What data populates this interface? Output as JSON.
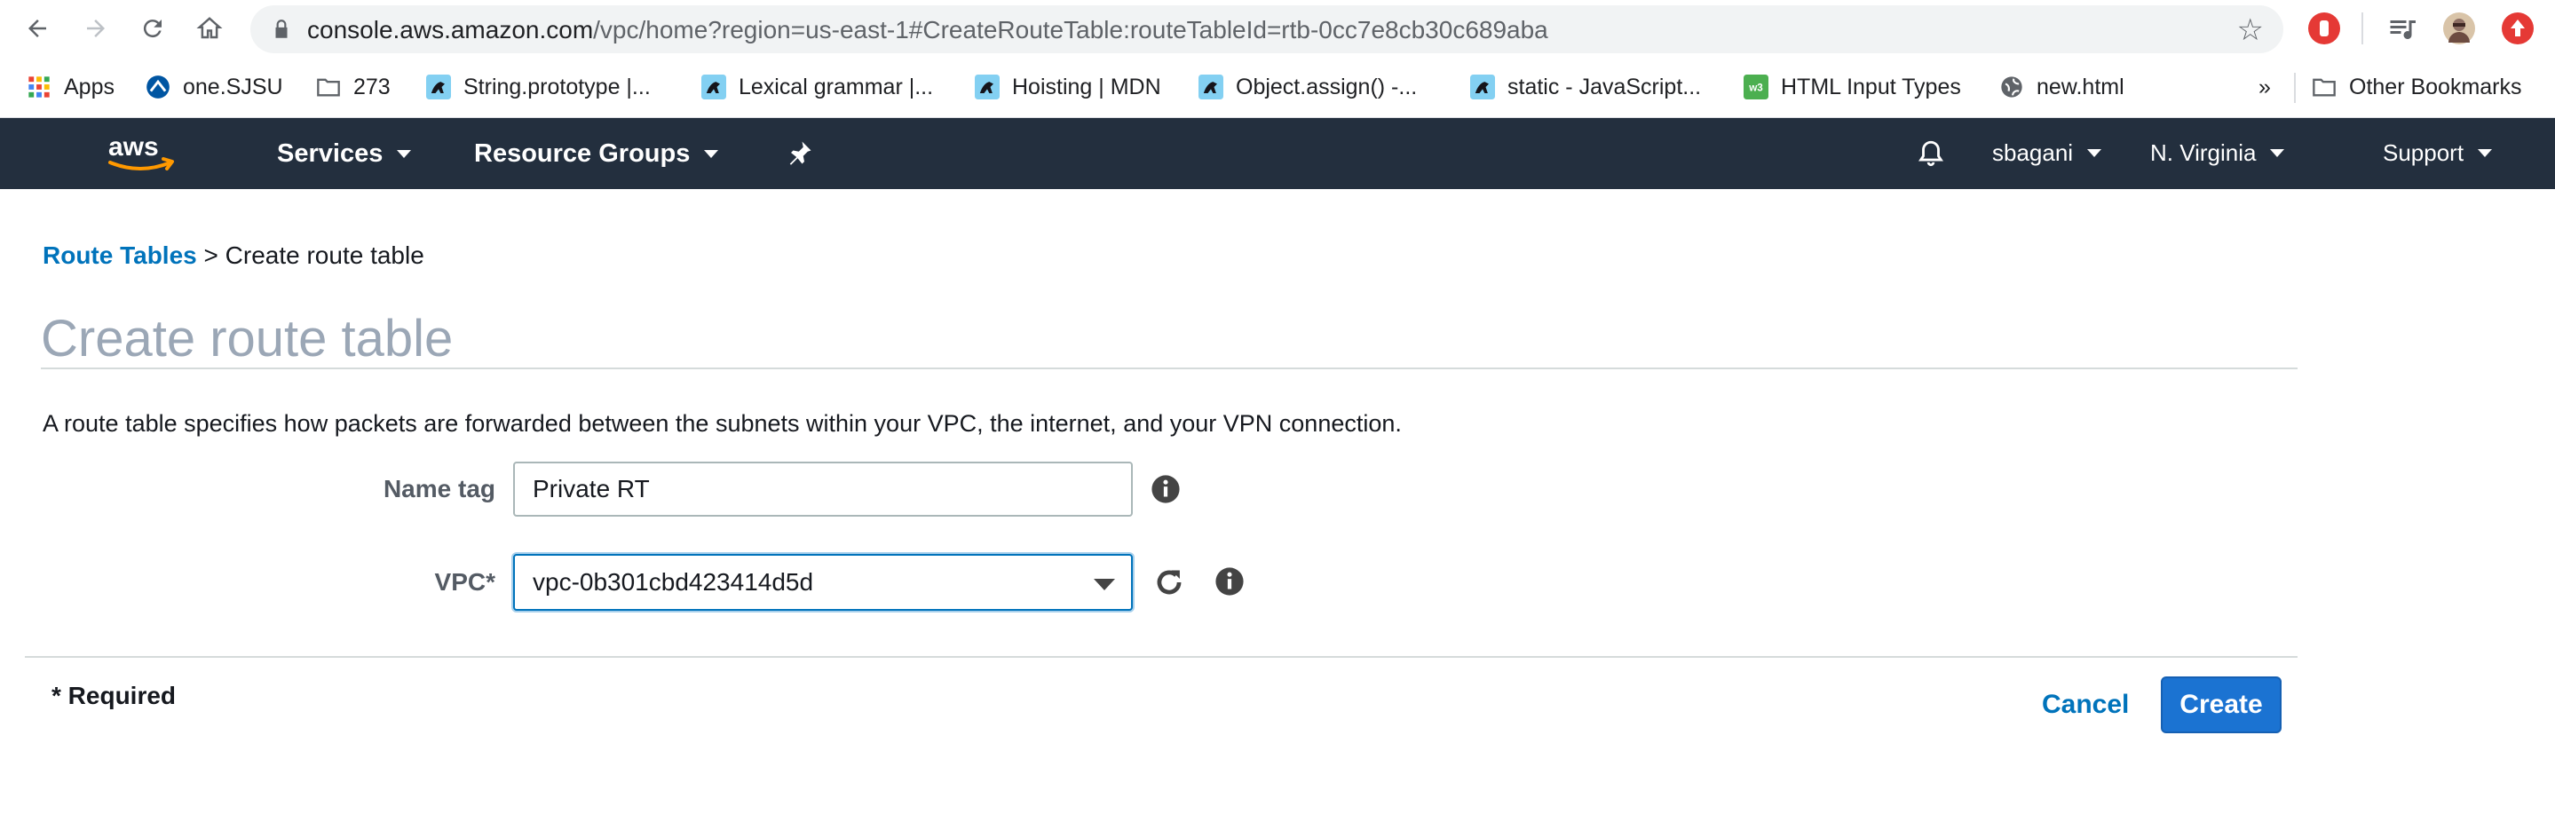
{
  "browser": {
    "url_host": "console.aws.amazon.com",
    "url_path": "/vpc/home?region=us-east-1#CreateRouteTable:routeTableId=rtb-0cc7e8cb30c689aba",
    "bookmarks": [
      {
        "label": "Apps",
        "icon": "apps-grid-icon"
      },
      {
        "label": "one.SJSU",
        "icon": "sjsu-icon"
      },
      {
        "label": "273",
        "icon": "folder-icon"
      },
      {
        "label": "String.prototype |...",
        "icon": "mdn-icon"
      },
      {
        "label": "Lexical grammar |...",
        "icon": "mdn-icon"
      },
      {
        "label": "Hoisting | MDN",
        "icon": "mdn-icon"
      },
      {
        "label": "Object.assign() -...",
        "icon": "mdn-icon"
      },
      {
        "label": "static - JavaScript...",
        "icon": "mdn-icon"
      },
      {
        "label": "HTML Input Types",
        "icon": "w3schools-icon"
      },
      {
        "label": "new.html",
        "icon": "globe-icon"
      }
    ],
    "overflow_label": "»",
    "other_bookmarks": "Other Bookmarks"
  },
  "aws_header": {
    "services": "Services",
    "resource_groups": "Resource Groups",
    "user": "sbagani",
    "region": "N. Virginia",
    "support": "Support"
  },
  "breadcrumb": {
    "parent": "Route Tables",
    "separator": ">",
    "current": "Create route table"
  },
  "page": {
    "title": "Create route table",
    "description": "A route table specifies how packets are forwarded between the subnets within your VPC, the internet, and your VPN connection."
  },
  "form": {
    "name_tag_label": "Name tag",
    "name_tag_value": "Private RT",
    "vpc_label": "VPC*",
    "vpc_value": "vpc-0b301cbd423414d5d"
  },
  "footer": {
    "required_note": "* Required",
    "cancel": "Cancel",
    "create": "Create"
  },
  "colors": {
    "aws_header_bg": "#232f3e",
    "link_blue": "#0073bb",
    "primary_button": "#1b73d2",
    "title_gray": "#9ba7b6"
  }
}
